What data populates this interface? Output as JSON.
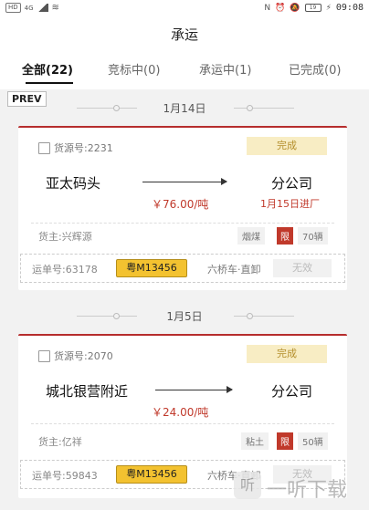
{
  "status_bar": {
    "left": [
      "HD",
      "4G"
    ],
    "battery": "19",
    "time": "09:08"
  },
  "header": {
    "title": "承运"
  },
  "tabs": [
    {
      "label": "全部(22)",
      "active": true
    },
    {
      "label": "竞标中(0)",
      "active": false
    },
    {
      "label": "承运中(1)",
      "active": false
    },
    {
      "label": "已完成(0)",
      "active": false
    }
  ],
  "overlay": {
    "prev_label": "PREV"
  },
  "groups": [
    {
      "date": "1月14日",
      "card": {
        "source_label": "货源号:2231",
        "status": "完成",
        "from": "亚太码头",
        "to": "分公司",
        "price": "￥76.00/吨",
        "arrival": "1月15日进厂",
        "owner": "货主:兴辉源",
        "goods": "烟煤",
        "limit": "限",
        "count": "70辆",
        "waybill_no": "运单号:63178",
        "plate": "粤M13456",
        "vehicle": "六桥车·直卸",
        "action": "无效"
      }
    },
    {
      "date": "1月5日",
      "card": {
        "source_label": "货源号:2070",
        "status": "完成",
        "from": "城北银营附近",
        "to": "分公司",
        "price": "￥24.00/吨",
        "owner": "货主:亿祥",
        "goods": "粘土",
        "limit": "限",
        "count": "50辆",
        "waybill_no": "运单号:59843",
        "plate": "粤M13456",
        "vehicle": "六桥车·直卸",
        "action": "无效"
      }
    }
  ],
  "watermark": {
    "logo": "听",
    "text": "一听下载"
  }
}
